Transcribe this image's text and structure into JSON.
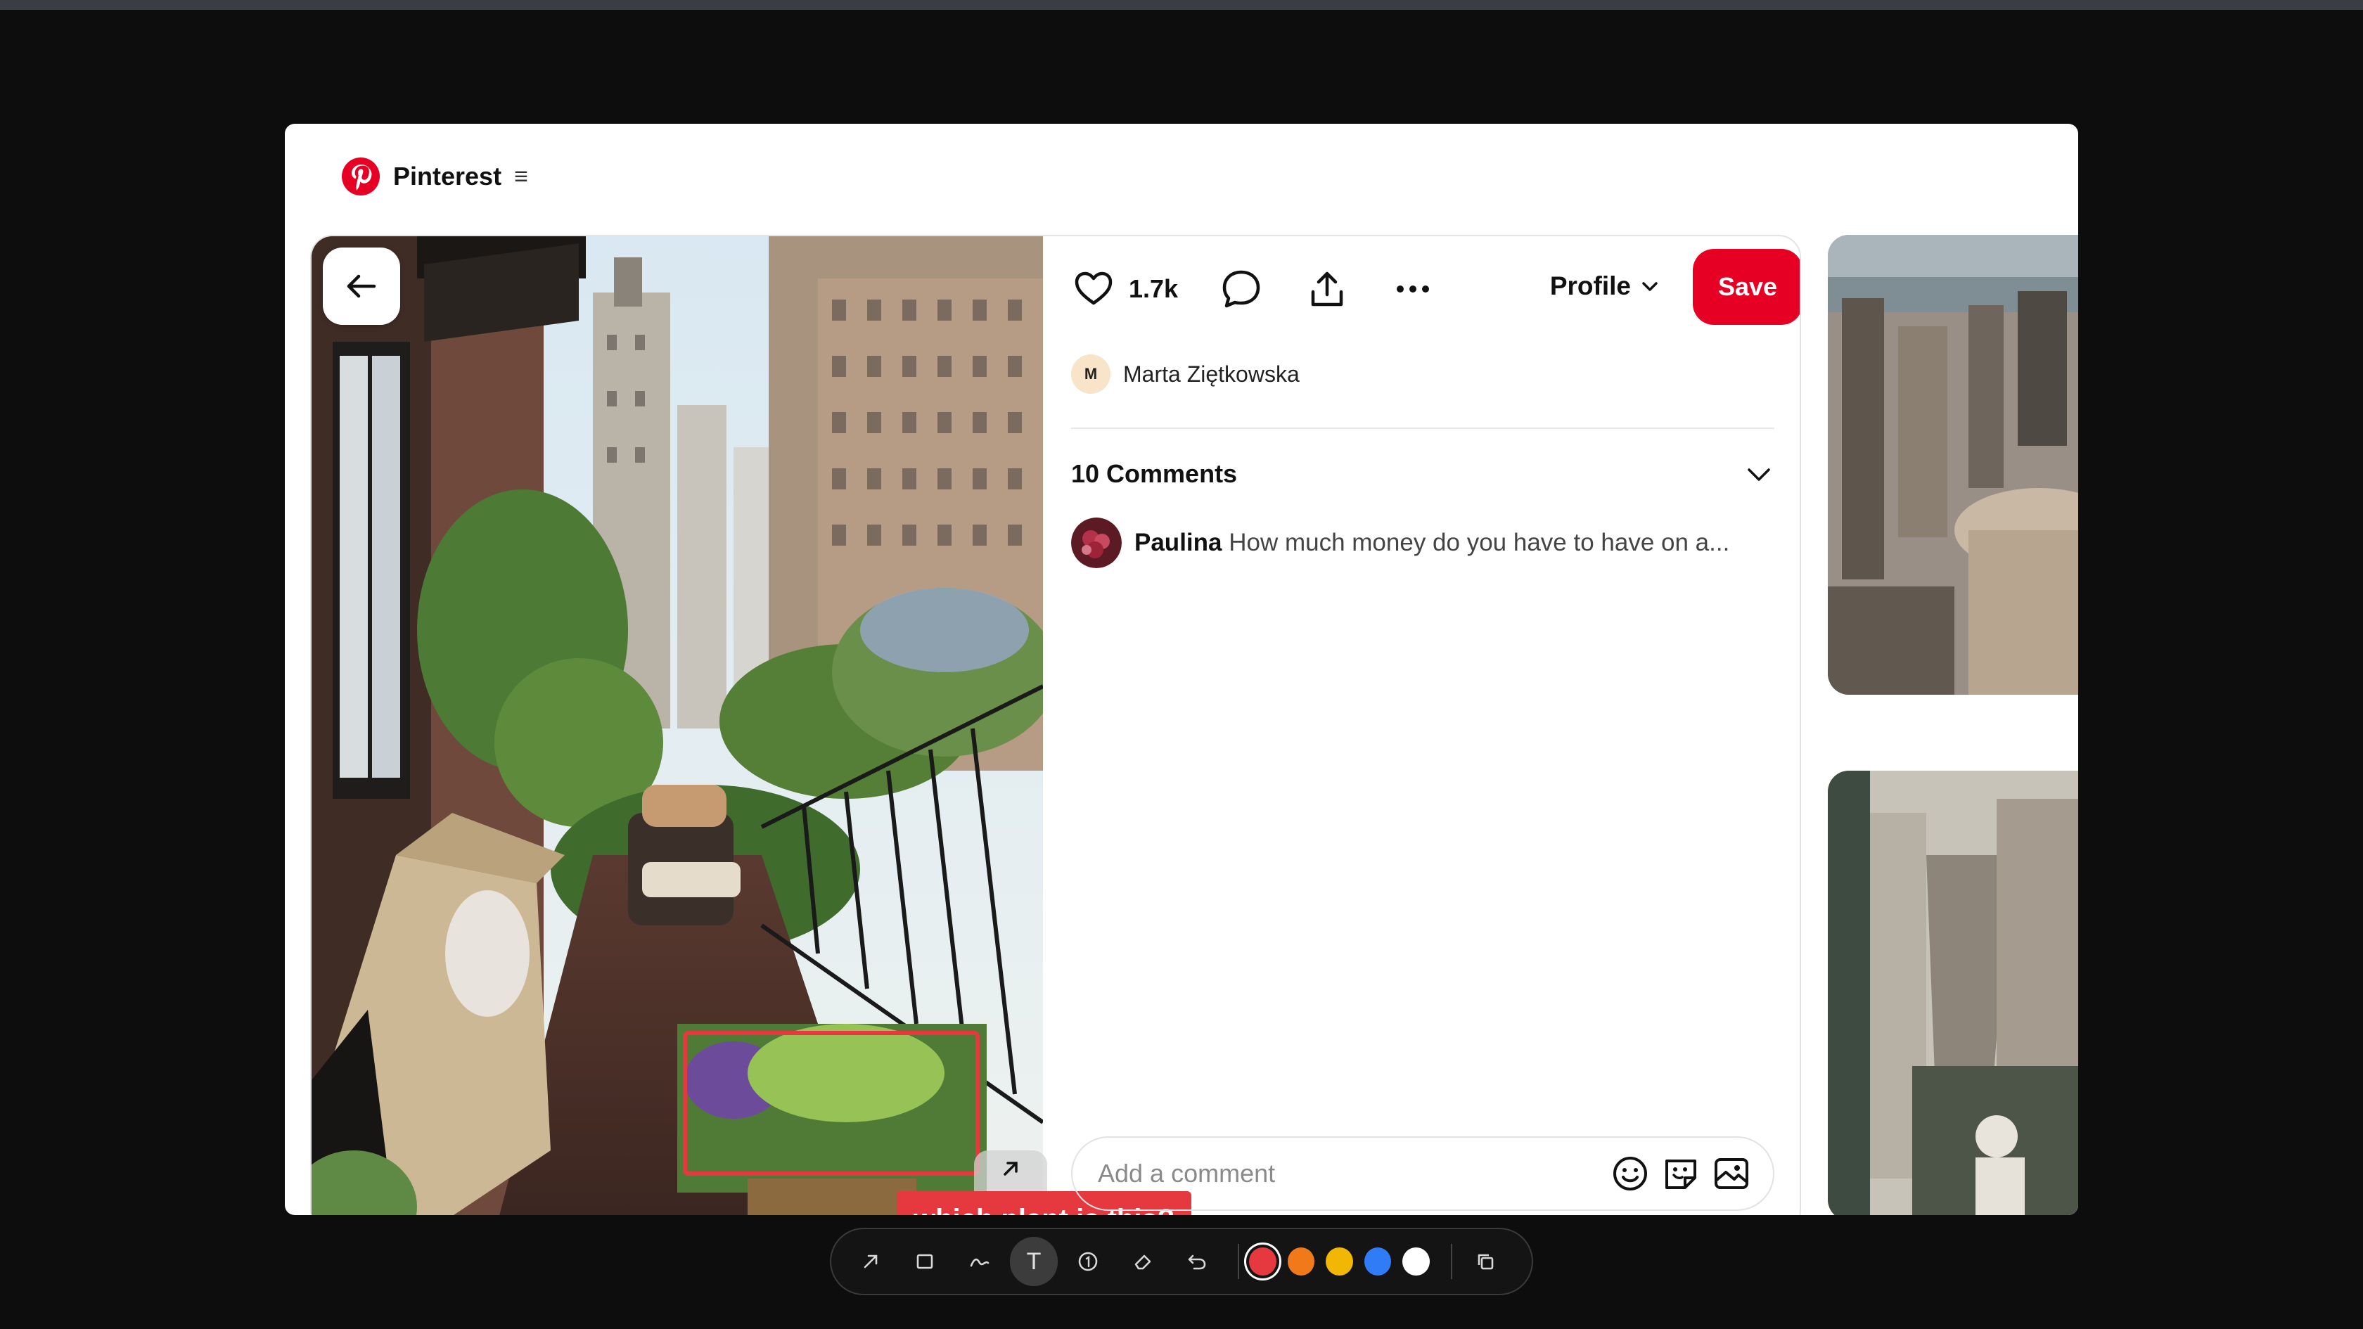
{
  "app": {
    "brand_name": "Pinterest",
    "menu_glyph": "≡"
  },
  "pin": {
    "like_count": "1.7k",
    "profile_label": "Profile",
    "save_label": "Save",
    "author": {
      "initial": "M",
      "name": "Marta Ziętkowska"
    },
    "comments": {
      "title": "10 Comments",
      "items": [
        {
          "user": "Paulina",
          "text": "How much money do you have to have on a..."
        }
      ],
      "input_placeholder": "Add a comment"
    }
  },
  "annotation": {
    "label": "which plant is this?",
    "color": "#e5393f"
  },
  "toolbar": {
    "text_tool_glyph": "T",
    "active_tool": "text",
    "colors": [
      "#e5393f",
      "#f07a1a",
      "#f2b705",
      "#2f7cf6",
      "#ffffff"
    ],
    "selected_color": "#e5393f"
  },
  "icons": [
    "back-arrow-icon",
    "heart-icon",
    "comment-icon",
    "share-icon",
    "more-icon",
    "chevron-down-icon",
    "emoji-icon",
    "sticker-icon",
    "image-icon",
    "visual-search-icon",
    "expand-icon"
  ]
}
